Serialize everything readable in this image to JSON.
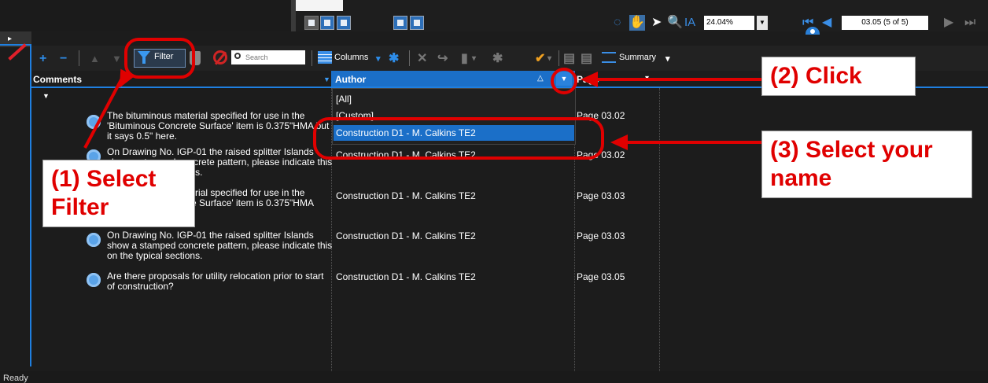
{
  "toolbar": {
    "zoom_value": "24.04%",
    "page_indicator": "03.05 (5 of 5)",
    "filter_label": "Filter",
    "search_placeholder": "Search",
    "columns_label": "Columns",
    "summary_label": "Summary"
  },
  "table": {
    "headers": {
      "comments": "Comments",
      "author": "Author",
      "page": "Page"
    },
    "rows": [
      {
        "comment": "The bituminous material specified for use in the 'Bituminous Concrete Surface' item is 0.375\"HMA but it says 0.5\" here.",
        "author": "Construction D1 - M. Calkins TE2",
        "page": "Page 03.02"
      },
      {
        "comment": "On Drawing No. IGP-01 the raised splitter Islands show a stamped concrete pattern, please indicate this on the typical sections.",
        "author": "Construction D1 - M. Calkins TE2",
        "page": "Page 03.02"
      },
      {
        "comment": "The bituminous material specified for use in the 'Bituminous Concrete Surface' item is 0.375\"HMA",
        "author": "Construction D1 - M. Calkins TE2",
        "page": "Page 03.03"
      },
      {
        "comment": "On Drawing No. IGP-01 the raised splitter Islands show a stamped concrete pattern, please indicate this on the typical sections.",
        "author": "Construction D1 - M. Calkins TE2",
        "page": "Page 03.03"
      },
      {
        "comment": "Are there proposals for utility relocation prior to start of construction?",
        "author": "Construction D1 - M. Calkins TE2",
        "page": "Page 03.05"
      }
    ]
  },
  "author_filter": {
    "options": [
      "[All]",
      "[Custom]",
      "Construction D1 - M. Calkins TE2"
    ],
    "selected": "Construction D1 - M. Calkins TE2"
  },
  "callouts": {
    "step1": "(1) Select Filter",
    "step2": "(2) Click",
    "step3": "(3) Select your name"
  },
  "status": "Ready",
  "colors": {
    "accent": "#1f7fe0",
    "annotation": "#e00000",
    "background": "#1c1c1c"
  }
}
